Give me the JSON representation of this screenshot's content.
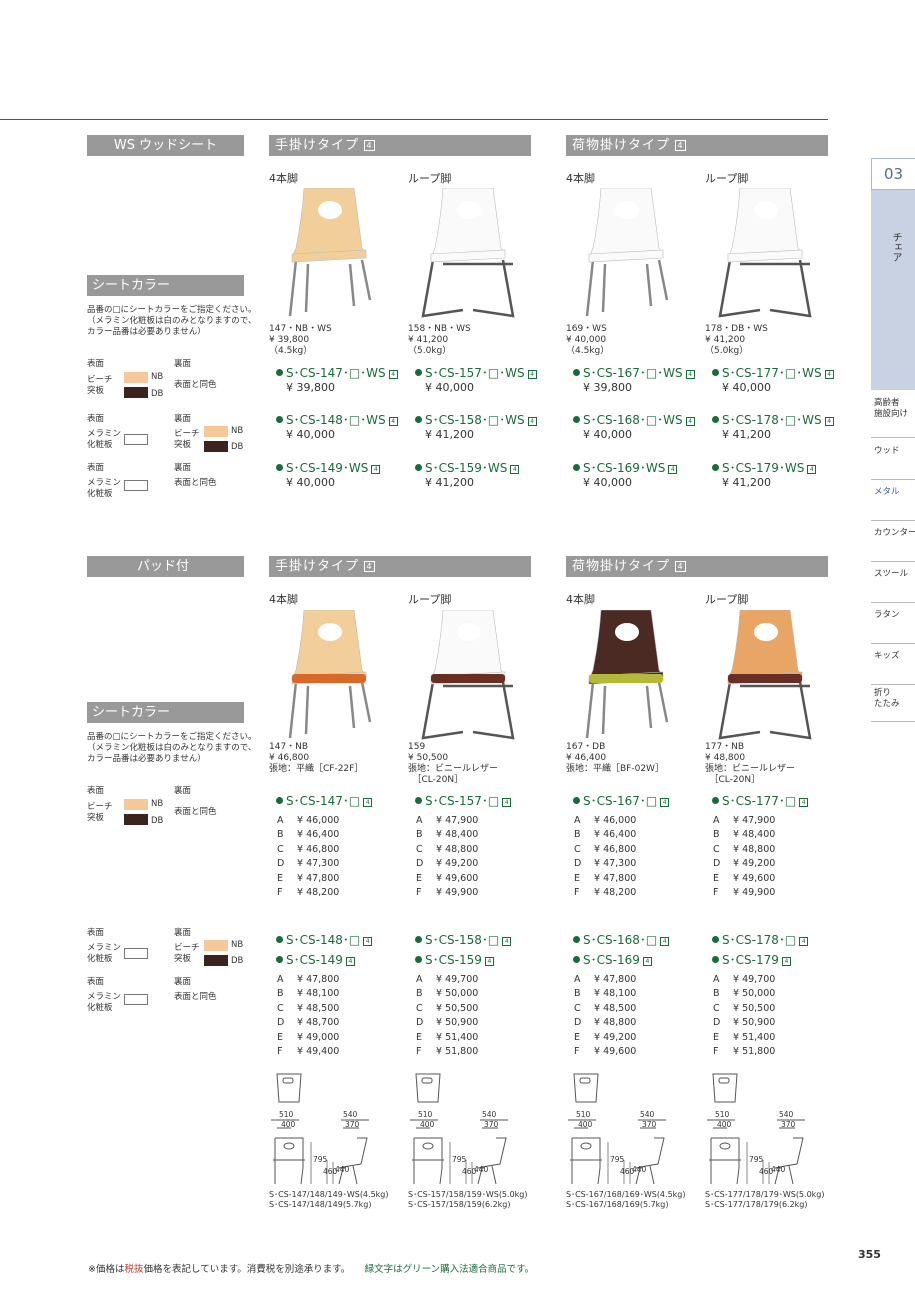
{
  "tabs": {
    "number": "03",
    "chair": "チェア",
    "items": [
      "高齢者\n施設向け",
      "ウッド",
      "メタル",
      "カウンター",
      "スツール",
      "ラタン",
      "キッズ",
      "折り\nたたみ"
    ]
  },
  "s1": {
    "left_title": "WS ウッドシート",
    "bar_a": "手掛けタイプ",
    "bar_b": "荷物掛けタイプ",
    "icon": "4",
    "sub": [
      "4本脚",
      "ループ脚",
      "4本脚",
      "ループ脚"
    ],
    "labels": [
      "147・NB・WS\n¥ 39,800\n（4.5kg）",
      "158・NB・WS\n¥ 41,200\n（5.0kg）",
      "169・WS\n¥ 40,000\n（4.5kg）",
      "178・DB・WS\n¥ 41,200\n（5.0kg）"
    ],
    "codes": [
      [
        {
          "c": "S･CS-147･□･WS",
          "p": "¥ 39,800"
        },
        {
          "c": "S･CS-148･□･WS",
          "p": "¥ 40,000"
        },
        {
          "c": "S･CS-149･WS",
          "p": "¥ 40,000"
        }
      ],
      [
        {
          "c": "S･CS-157･□･WS",
          "p": "¥ 40,000"
        },
        {
          "c": "S･CS-158･□･WS",
          "p": "¥ 41,200"
        },
        {
          "c": "S･CS-159･WS",
          "p": "¥ 41,200"
        }
      ],
      [
        {
          "c": "S･CS-167･□･WS",
          "p": "¥ 39,800"
        },
        {
          "c": "S･CS-168･□･WS",
          "p": "¥ 40,000"
        },
        {
          "c": "S･CS-169･WS",
          "p": "¥ 40,000"
        }
      ],
      [
        {
          "c": "S･CS-177･□･WS",
          "p": "¥ 40,000"
        },
        {
          "c": "S･CS-178･□･WS",
          "p": "¥ 41,200"
        },
        {
          "c": "S･CS-179･WS",
          "p": "¥ 41,200"
        }
      ]
    ]
  },
  "seatcolor": {
    "title": "シートカラー",
    "note": "品番の□にシートカラーをご指定ください。\n（メラミン化粧板は白のみとなりますので、\nカラー品番は必要ありません）",
    "front": "表面",
    "back": "裏面",
    "beech": "ビーチ\n突板",
    "melamine": "メラミン\n化粧板",
    "nb": "NB",
    "db": "DB",
    "same": "表面と同色"
  },
  "s2": {
    "left_title": "パッド付",
    "labels": [
      "147・NB\n¥ 46,800\n張地：平織［CF-22F］",
      "159\n¥ 50,500\n張地：ビニールレザー\n　［CL-20N］",
      "167・DB\n¥ 46,400\n張地：平織［BF-02W］",
      "177・NB\n¥ 48,800\n張地：ビニールレザー\n　［CL-20N］"
    ],
    "codes_a": [
      "S･CS-147･□",
      "S･CS-157･□",
      "S･CS-167･□",
      "S･CS-177･□"
    ],
    "codes_b1": [
      "S･CS-148･□",
      "S･CS-158･□",
      "S･CS-168･□",
      "S･CS-178･□"
    ],
    "codes_b2": [
      "S･CS-149",
      "S･CS-159",
      "S･CS-169",
      "S･CS-179"
    ],
    "keys": [
      "A",
      "B",
      "C",
      "D",
      "E",
      "F"
    ],
    "prices_a": [
      [
        "¥ 46,000",
        "¥ 46,400",
        "¥ 46,800",
        "¥ 47,300",
        "¥ 47,800",
        "¥ 48,200"
      ],
      [
        "¥ 47,900",
        "¥ 48,400",
        "¥ 48,800",
        "¥ 49,200",
        "¥ 49,600",
        "¥ 49,900"
      ],
      [
        "¥ 46,000",
        "¥ 46,400",
        "¥ 46,800",
        "¥ 47,300",
        "¥ 47,800",
        "¥ 48,200"
      ],
      [
        "¥ 47,900",
        "¥ 48,400",
        "¥ 48,800",
        "¥ 49,200",
        "¥ 49,600",
        "¥ 49,900"
      ]
    ],
    "prices_b": [
      [
        "¥ 47,800",
        "¥ 48,100",
        "¥ 48,500",
        "¥ 48,700",
        "¥ 49,000",
        "¥ 49,400"
      ],
      [
        "¥ 49,700",
        "¥ 50,000",
        "¥ 50,500",
        "¥ 50,900",
        "¥ 51,400",
        "¥ 51,800"
      ],
      [
        "¥ 47,800",
        "¥ 48,100",
        "¥ 48,500",
        "¥ 48,800",
        "¥ 49,200",
        "¥ 49,600"
      ],
      [
        "¥ 49,700",
        "¥ 50,000",
        "¥ 50,500",
        "¥ 50,900",
        "¥ 51,400",
        "¥ 51,800"
      ]
    ]
  },
  "dims": {
    "w1": "510",
    "w2": "400",
    "d1": "540",
    "d2": "370",
    "h1": "795",
    "h2": "460",
    "h3": "440",
    "captions": [
      "S･CS-147/148/149･WS(4.5kg)\nS･CS-147/148/149(5.7kg)",
      "S･CS-157/158/159･WS(5.0kg)\nS･CS-157/158/159(6.2kg)",
      "S･CS-167/168/169･WS(4.5kg)\nS･CS-167/168/169(5.7kg)",
      "S･CS-177/178/179･WS(5.0kg)\nS･CS-177/178/179(6.2kg)"
    ]
  },
  "footer": {
    "note1": "※価格は",
    "note2": "税抜",
    "note3": "価格を表記しています。消費税を別途承ります。",
    "note4": "緑文字はグリーン購入法適合商品です。",
    "page": "355"
  },
  "colors": {
    "green": "#1a6b3a",
    "bar": "#999999",
    "nb": "#f4c89a",
    "db": "#3b2320",
    "tab": "#c8d2e2"
  }
}
